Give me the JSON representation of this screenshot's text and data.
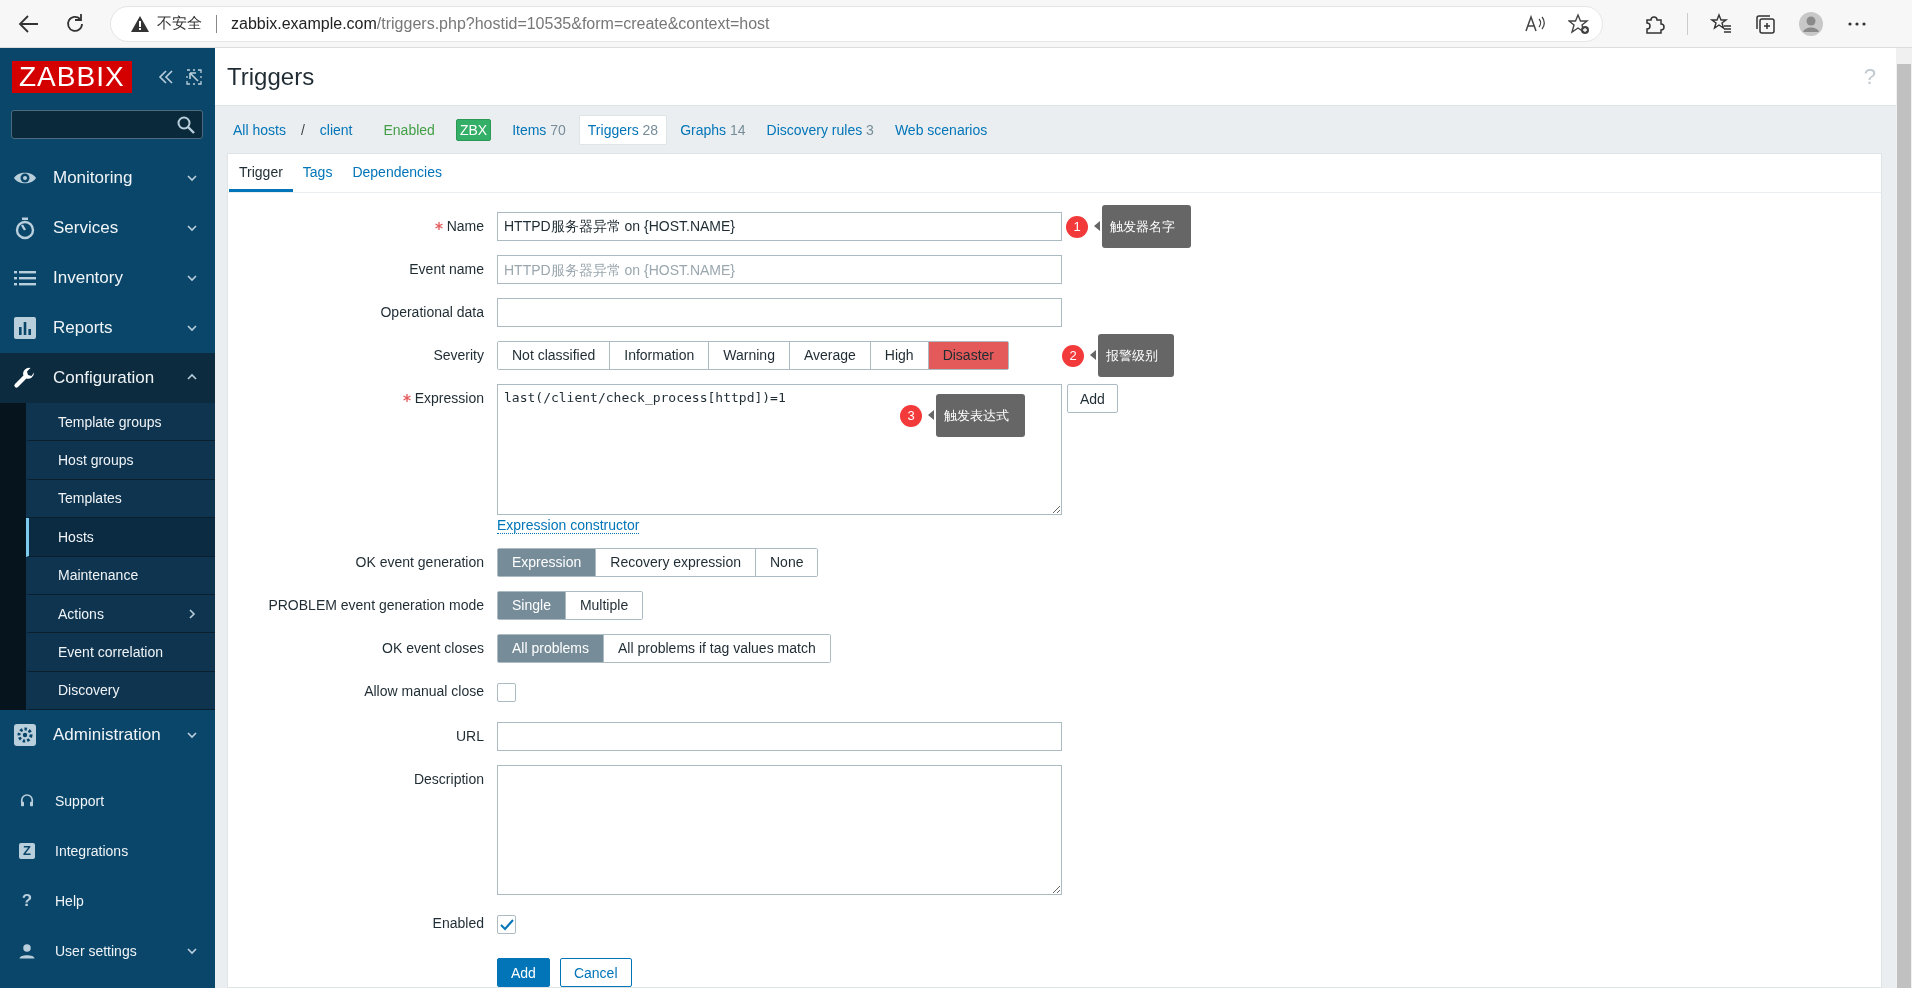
{
  "browser": {
    "security": "不安全",
    "host": "zabbix.example.com",
    "path": "/triggers.php?hostid=10535&form=create&context=host"
  },
  "sidebar": {
    "logo": "ZABBIX",
    "menu": [
      {
        "label": "Monitoring",
        "expanded": false
      },
      {
        "label": "Services",
        "expanded": false
      },
      {
        "label": "Inventory",
        "expanded": false
      },
      {
        "label": "Reports",
        "expanded": false
      },
      {
        "label": "Configuration",
        "expanded": true,
        "children": [
          {
            "label": "Template groups",
            "selected": false,
            "submenu": false
          },
          {
            "label": "Host groups",
            "selected": false,
            "submenu": false
          },
          {
            "label": "Templates",
            "selected": false,
            "submenu": false
          },
          {
            "label": "Hosts",
            "selected": true,
            "submenu": false
          },
          {
            "label": "Maintenance",
            "selected": false,
            "submenu": false
          },
          {
            "label": "Actions",
            "selected": false,
            "submenu": true
          },
          {
            "label": "Event correlation",
            "selected": false,
            "submenu": false
          },
          {
            "label": "Discovery",
            "selected": false,
            "submenu": false
          }
        ]
      },
      {
        "label": "Administration",
        "expanded": false
      }
    ],
    "footer": [
      {
        "label": "Support",
        "expandable": false
      },
      {
        "label": "Integrations",
        "glyph": "Z",
        "expandable": false
      },
      {
        "label": "Help",
        "glyph": "?",
        "expandable": false
      },
      {
        "label": "User settings",
        "expandable": true
      }
    ]
  },
  "page": {
    "title": "Triggers",
    "help": "?"
  },
  "host_nav": [
    {
      "kind": "link",
      "label": "All hosts"
    },
    {
      "kind": "separator",
      "label": "/"
    },
    {
      "kind": "link",
      "label": "client"
    },
    {
      "kind": "status",
      "label": "Enabled"
    },
    {
      "kind": "badge",
      "label": "ZBX"
    },
    {
      "kind": "tab",
      "label": "Items",
      "count": "70",
      "selected": false
    },
    {
      "kind": "tab",
      "label": "Triggers",
      "count": "28",
      "selected": true
    },
    {
      "kind": "tab",
      "label": "Graphs",
      "count": "14",
      "selected": false
    },
    {
      "kind": "tab",
      "label": "Discovery rules",
      "count": "3",
      "selected": false
    },
    {
      "kind": "tab",
      "label": "Web scenarios",
      "selected": false
    }
  ],
  "form_tabs": [
    {
      "label": "Trigger",
      "selected": true
    },
    {
      "label": "Tags",
      "selected": false
    },
    {
      "label": "Dependencies",
      "selected": false
    }
  ],
  "fields": [
    {
      "kind": "text",
      "label": "Name",
      "required": true,
      "value": "HTTPD服务器异常 on {HOST.NAME}",
      "callout": {
        "number": "1",
        "text": "触发器名字"
      }
    },
    {
      "kind": "text",
      "label": "Event name",
      "required": false,
      "placeholder": "HTTPD服务器异常 on {HOST.NAME}"
    },
    {
      "kind": "text",
      "label": "Operational data",
      "required": false
    },
    {
      "kind": "severity",
      "label": "Severity",
      "required": false,
      "options": [
        {
          "label": "Not classified",
          "selected": false
        },
        {
          "label": "Information",
          "selected": false
        },
        {
          "label": "Warning",
          "selected": false
        },
        {
          "label": "Average",
          "selected": false
        },
        {
          "label": "High",
          "selected": false
        },
        {
          "label": "Disaster",
          "selected": true
        }
      ],
      "callout": {
        "number": "2",
        "text": "报警级别"
      }
    },
    {
      "kind": "expression",
      "label": "Expression",
      "required": true,
      "value": "last(/client/check_process[httpd])=1",
      "button": "Add",
      "link": "Expression constructor",
      "callout": {
        "number": "3",
        "text": "触发表达式"
      }
    },
    {
      "kind": "segmented",
      "label": "OK event generation",
      "required": false,
      "options": [
        {
          "label": "Expression",
          "selected": true
        },
        {
          "label": "Recovery expression",
          "selected": false
        },
        {
          "label": "None",
          "selected": false
        }
      ]
    },
    {
      "kind": "segmented",
      "label": "PROBLEM event generation mode",
      "required": false,
      "options": [
        {
          "label": "Single",
          "selected": true
        },
        {
          "label": "Multiple",
          "selected": false
        }
      ]
    },
    {
      "kind": "segmented",
      "label": "OK event closes",
      "required": false,
      "options": [
        {
          "label": "All problems",
          "selected": true
        },
        {
          "label": "All problems if tag values match",
          "selected": false
        }
      ]
    },
    {
      "kind": "checkbox",
      "label": "Allow manual close",
      "required": false,
      "checked": false
    },
    {
      "kind": "text",
      "label": "URL",
      "required": false
    },
    {
      "kind": "textarea",
      "label": "Description",
      "required": false
    },
    {
      "kind": "checkbox",
      "label": "Enabled",
      "required": false,
      "checked": true
    }
  ],
  "actions": [
    {
      "label": "Add",
      "primary": true
    },
    {
      "label": "Cancel",
      "primary": false
    }
  ]
}
